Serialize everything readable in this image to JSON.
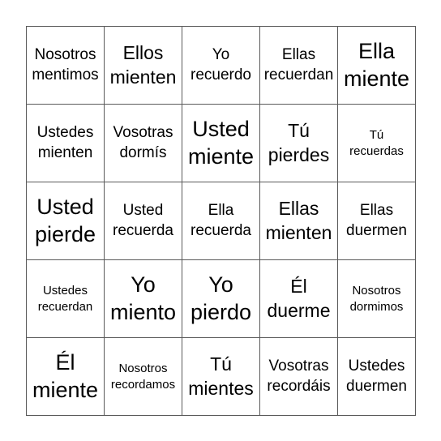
{
  "card": {
    "rows": [
      [
        {
          "line1": "Nosotros",
          "line2": "mentimos",
          "size": "md"
        },
        {
          "line1": "Ellos",
          "line2": "mienten",
          "size": "lg"
        },
        {
          "line1": "Yo",
          "line2": "recuerdo",
          "size": "md"
        },
        {
          "line1": "Ellas",
          "line2": "recuerdan",
          "size": "md"
        },
        {
          "line1": "Ella",
          "line2": "miente",
          "size": "xl"
        }
      ],
      [
        {
          "line1": "Ustedes",
          "line2": "mienten",
          "size": "md"
        },
        {
          "line1": "Vosotras",
          "line2": "dormís",
          "size": "md"
        },
        {
          "line1": "Usted",
          "line2": "miente",
          "size": "xl"
        },
        {
          "line1": "Tú",
          "line2": "pierdes",
          "size": "lg"
        },
        {
          "line1": "Tú",
          "line2": "recuerdas",
          "size": "sm"
        }
      ],
      [
        {
          "line1": "Usted",
          "line2": "pierde",
          "size": "xl"
        },
        {
          "line1": "Usted",
          "line2": "recuerda",
          "size": "md"
        },
        {
          "line1": "Ella",
          "line2": "recuerda",
          "size": "md"
        },
        {
          "line1": "Ellas",
          "line2": "mienten",
          "size": "lg"
        },
        {
          "line1": "Ellas",
          "line2": "duermen",
          "size": "md"
        }
      ],
      [
        {
          "line1": "Ustedes",
          "line2": "recuerdan",
          "size": "sm"
        },
        {
          "line1": "Yo",
          "line2": "miento",
          "size": "xl"
        },
        {
          "line1": "Yo",
          "line2": "pierdo",
          "size": "xl"
        },
        {
          "line1": "Él",
          "line2": "duerme",
          "size": "lg"
        },
        {
          "line1": "Nosotros",
          "line2": "dormimos",
          "size": "sm"
        }
      ],
      [
        {
          "line1": "Él",
          "line2": "miente",
          "size": "xl"
        },
        {
          "line1": "Nosotros",
          "line2": "recordamos",
          "size": "sm"
        },
        {
          "line1": "Tú",
          "line2": "mientes",
          "size": "lg"
        },
        {
          "line1": "Vosotras",
          "line2": "recordáis",
          "size": "md"
        },
        {
          "line1": "Ustedes",
          "line2": "duermen",
          "size": "md"
        }
      ]
    ]
  }
}
